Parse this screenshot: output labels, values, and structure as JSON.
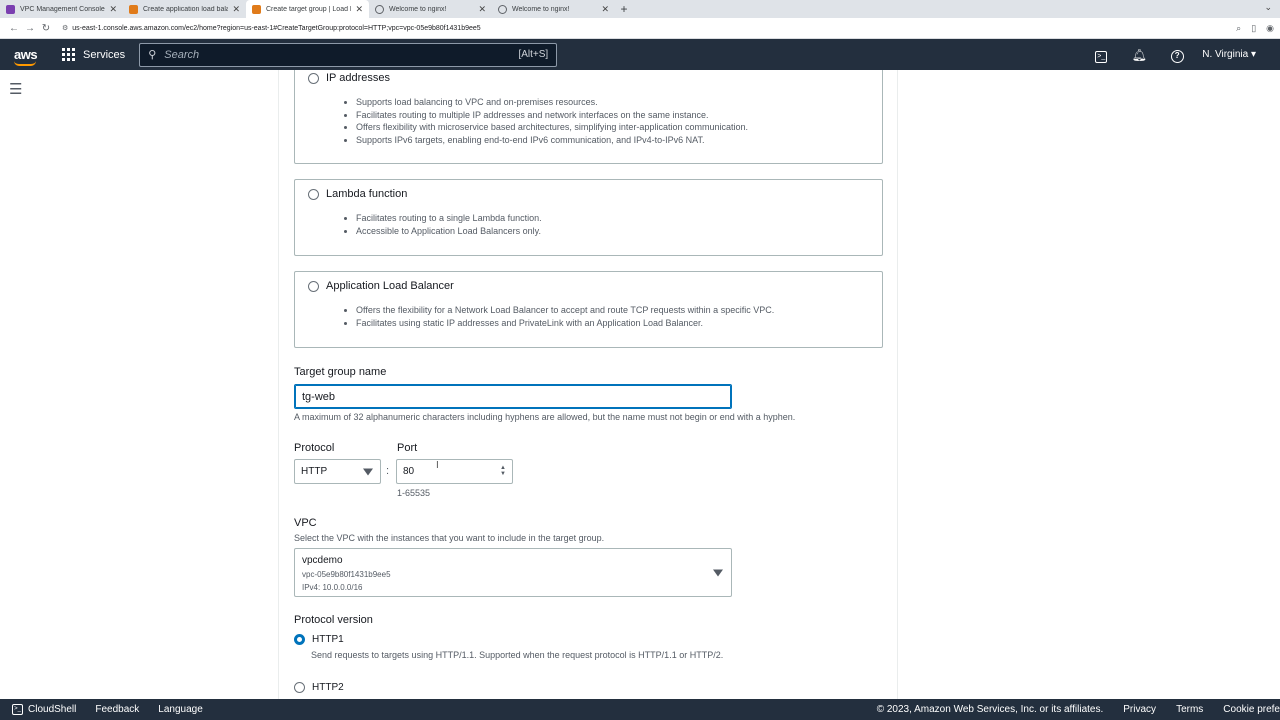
{
  "browser": {
    "tabs": [
      {
        "title": "VPC Management Console",
        "favicon": "purple"
      },
      {
        "title": "Create application load balancer",
        "favicon": "orange"
      },
      {
        "title": "Create target group | Load Balancing",
        "favicon": "orange",
        "active": true
      },
      {
        "title": "Welcome to nginx!",
        "favicon": "globe"
      },
      {
        "title": "Welcome to nginx!",
        "favicon": "globe"
      }
    ],
    "url": "us-east-1.console.aws.amazon.com/ec2/home?region=us-east-1#CreateTargetGroup:protocol=HTTP;vpc=vpc-05e9b80f1431b9ee5"
  },
  "header": {
    "logo": "aws",
    "services_label": "Services",
    "search_placeholder": "Search",
    "search_shortcut": "[Alt+S]",
    "region": "N. Virginia"
  },
  "options": [
    {
      "title": "IP addresses",
      "bullets": [
        "Supports load balancing to VPC and on-premises resources.",
        "Facilitates routing to multiple IP addresses and network interfaces on the same instance.",
        "Offers flexibility with microservice based architectures, simplifying inter-application communication.",
        "Supports IPv6 targets, enabling end-to-end IPv6 communication, and IPv4-to-IPv6 NAT."
      ]
    },
    {
      "title": "Lambda function",
      "bullets": [
        "Facilitates routing to a single Lambda function.",
        "Accessible to Application Load Balancers only."
      ]
    },
    {
      "title": "Application Load Balancer",
      "bullets": [
        "Offers the flexibility for a Network Load Balancer to accept and route TCP requests within a specific VPC.",
        "Facilitates using static IP addresses and PrivateLink with an Application Load Balancer."
      ]
    }
  ],
  "target_group": {
    "label": "Target group name",
    "value": "tg-web",
    "help": "A maximum of 32 alphanumeric characters including hyphens are allowed, but the name must not begin or end with a hyphen."
  },
  "protocol": {
    "label": "Protocol",
    "value": "HTTP"
  },
  "port": {
    "label": "Port",
    "value": "80",
    "range": "1-65535"
  },
  "vpc": {
    "label": "VPC",
    "help": "Select the VPC with the instances that you want to include in the target group.",
    "name": "vpcdemo",
    "id": "vpc-05e9b80f1431b9ee5",
    "cidr": "IPv4: 10.0.0.0/16"
  },
  "protocol_version": {
    "label": "Protocol version",
    "http1_label": "HTTP1",
    "http1_desc": "Send requests to targets using HTTP/1.1. Supported when the request protocol is HTTP/1.1 or HTTP/2.",
    "http2_label": "HTTP2"
  },
  "footer": {
    "cloudshell": "CloudShell",
    "feedback": "Feedback",
    "language": "Language",
    "copyright": "© 2023, Amazon Web Services, Inc. or its affiliates.",
    "privacy": "Privacy",
    "terms": "Terms",
    "cookie": "Cookie prefe"
  },
  "colors": {
    "aws_nav": "#232f3e",
    "accent": "#0073bb",
    "brand_orange": "#ff9900"
  }
}
